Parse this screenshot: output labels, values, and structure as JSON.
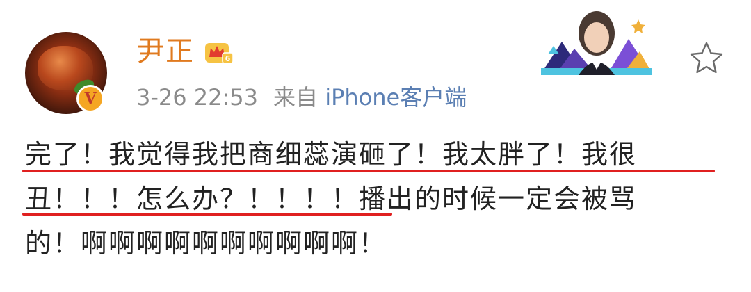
{
  "post": {
    "username": "尹正",
    "timestamp": "3-26 22:53",
    "source_prefix": "来自",
    "source_name": "iPhone客户端",
    "verified_badge": "V",
    "vip_level": "6",
    "body_lines": [
      "完了！我觉得我把商细蕊演砸了！我太胖了！我很",
      "丑！！！怎么办？！！！！播出的时候一定会被骂",
      "的！啊啊啊啊啊啊啊啊啊啊！"
    ]
  },
  "icons": {
    "avatar": "braised-pork-avatar",
    "verified": "verified-v-icon",
    "crown": "vip-crown-icon",
    "promo": "celebrity-promo-banner",
    "favorite": "star-icon"
  },
  "colors": {
    "username": "#e07a1f",
    "meta": "#8a8a8a",
    "source": "#5b7fb3",
    "underline": "#e02020",
    "body": "#222222"
  }
}
